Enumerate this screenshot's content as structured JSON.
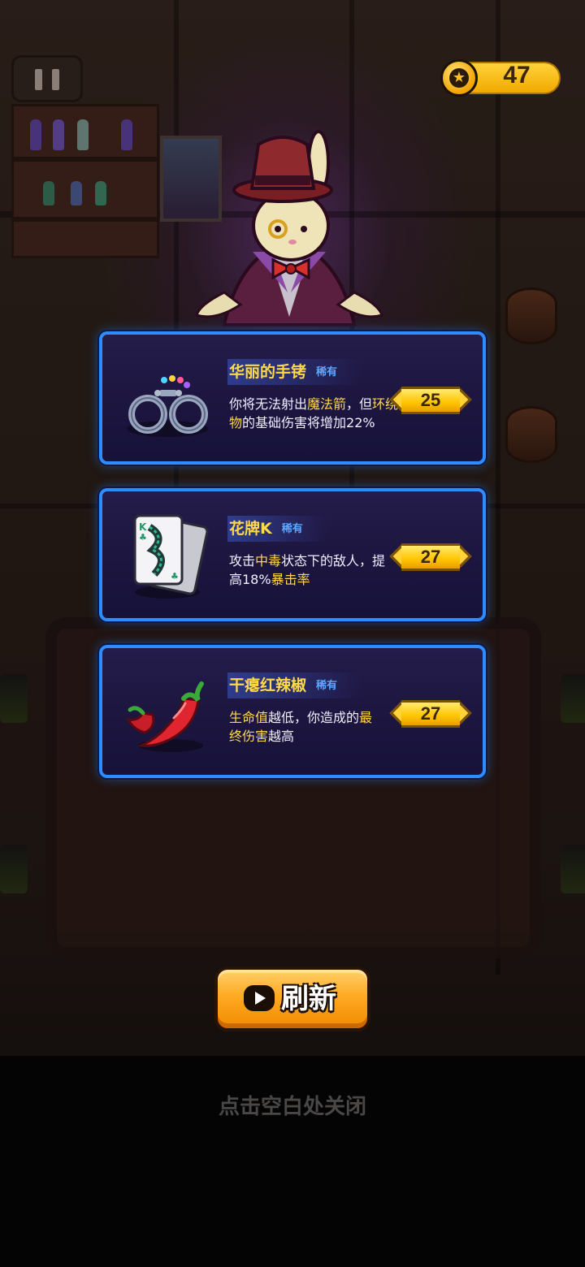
{
  "hud": {
    "coins": "47"
  },
  "offers": [
    {
      "name": "华丽的手铐",
      "rarity": "稀有",
      "icon": "handcuffs-icon",
      "desc_parts": [
        {
          "text": "你将无法射出",
          "hl": false
        },
        {
          "text": "魔法箭",
          "hl": true
        },
        {
          "text": "，但",
          "hl": false
        },
        {
          "text": "环绕物",
          "hl": true
        },
        {
          "text": "的基础伤害将增加22%",
          "hl": false
        }
      ],
      "price": "25"
    },
    {
      "name": "花牌K",
      "rarity": "稀有",
      "icon": "king-card-icon",
      "desc_parts": [
        {
          "text": "攻击",
          "hl": false
        },
        {
          "text": "中毒",
          "hl": true
        },
        {
          "text": "状态下的敌人，提高18%",
          "hl": false
        },
        {
          "text": "暴击率",
          "hl": true
        }
      ],
      "price": "27"
    },
    {
      "name": "干瘪红辣椒",
      "rarity": "稀有",
      "icon": "red-pepper-icon",
      "desc_parts": [
        {
          "text": "生命值",
          "hl": true
        },
        {
          "text": "越低，你造成的",
          "hl": false
        },
        {
          "text": "最终伤害",
          "hl": true
        },
        {
          "text": "越高",
          "hl": false
        }
      ],
      "price": "27"
    }
  ],
  "refresh_label": "刷新",
  "close_hint": "点击空白处关闭",
  "colors": {
    "card_border": "#2f8cff",
    "highlight_text": "#ffd94a",
    "rarity_text": "#5aa8ff",
    "coin_gold": "#ffc400"
  }
}
